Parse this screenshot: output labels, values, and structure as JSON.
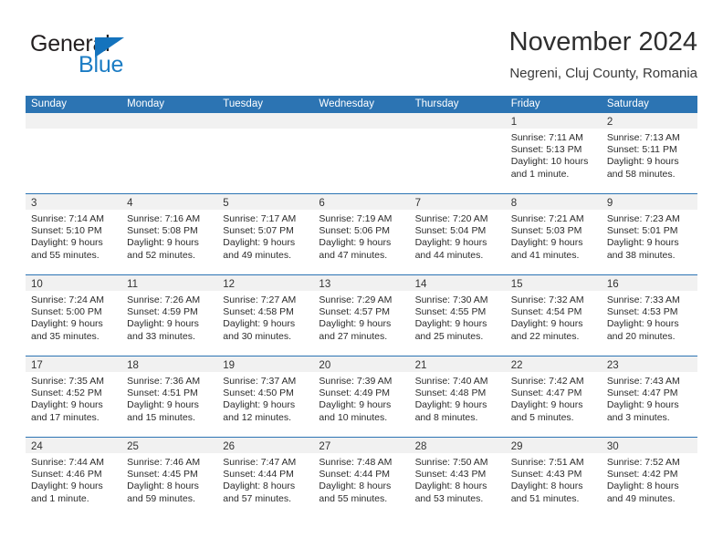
{
  "brand": {
    "name_top": "General",
    "name_bottom": "Blue",
    "triangle_color": "#1473bd",
    "text_color": "#231f20",
    "blue_text_color": "#1b7cc4"
  },
  "header": {
    "title": "November 2024",
    "subtitle": "Negreni, Cluj County, Romania"
  },
  "theme": {
    "header_blue": "#2c74b3",
    "band_gray": "#f1f1f1",
    "text": "#2b2b2b"
  },
  "weekdays": [
    "Sunday",
    "Monday",
    "Tuesday",
    "Wednesday",
    "Thursday",
    "Friday",
    "Saturday"
  ],
  "weeks": [
    [
      {
        "day": ""
      },
      {
        "day": ""
      },
      {
        "day": ""
      },
      {
        "day": ""
      },
      {
        "day": ""
      },
      {
        "day": "1",
        "sunrise": "Sunrise: 7:11 AM",
        "sunset": "Sunset: 5:13 PM",
        "daylight_1": "Daylight: 10 hours",
        "daylight_2": "and 1 minute."
      },
      {
        "day": "2",
        "sunrise": "Sunrise: 7:13 AM",
        "sunset": "Sunset: 5:11 PM",
        "daylight_1": "Daylight: 9 hours",
        "daylight_2": "and 58 minutes."
      }
    ],
    [
      {
        "day": "3",
        "sunrise": "Sunrise: 7:14 AM",
        "sunset": "Sunset: 5:10 PM",
        "daylight_1": "Daylight: 9 hours",
        "daylight_2": "and 55 minutes."
      },
      {
        "day": "4",
        "sunrise": "Sunrise: 7:16 AM",
        "sunset": "Sunset: 5:08 PM",
        "daylight_1": "Daylight: 9 hours",
        "daylight_2": "and 52 minutes."
      },
      {
        "day": "5",
        "sunrise": "Sunrise: 7:17 AM",
        "sunset": "Sunset: 5:07 PM",
        "daylight_1": "Daylight: 9 hours",
        "daylight_2": "and 49 minutes."
      },
      {
        "day": "6",
        "sunrise": "Sunrise: 7:19 AM",
        "sunset": "Sunset: 5:06 PM",
        "daylight_1": "Daylight: 9 hours",
        "daylight_2": "and 47 minutes."
      },
      {
        "day": "7",
        "sunrise": "Sunrise: 7:20 AM",
        "sunset": "Sunset: 5:04 PM",
        "daylight_1": "Daylight: 9 hours",
        "daylight_2": "and 44 minutes."
      },
      {
        "day": "8",
        "sunrise": "Sunrise: 7:21 AM",
        "sunset": "Sunset: 5:03 PM",
        "daylight_1": "Daylight: 9 hours",
        "daylight_2": "and 41 minutes."
      },
      {
        "day": "9",
        "sunrise": "Sunrise: 7:23 AM",
        "sunset": "Sunset: 5:01 PM",
        "daylight_1": "Daylight: 9 hours",
        "daylight_2": "and 38 minutes."
      }
    ],
    [
      {
        "day": "10",
        "sunrise": "Sunrise: 7:24 AM",
        "sunset": "Sunset: 5:00 PM",
        "daylight_1": "Daylight: 9 hours",
        "daylight_2": "and 35 minutes."
      },
      {
        "day": "11",
        "sunrise": "Sunrise: 7:26 AM",
        "sunset": "Sunset: 4:59 PM",
        "daylight_1": "Daylight: 9 hours",
        "daylight_2": "and 33 minutes."
      },
      {
        "day": "12",
        "sunrise": "Sunrise: 7:27 AM",
        "sunset": "Sunset: 4:58 PM",
        "daylight_1": "Daylight: 9 hours",
        "daylight_2": "and 30 minutes."
      },
      {
        "day": "13",
        "sunrise": "Sunrise: 7:29 AM",
        "sunset": "Sunset: 4:57 PM",
        "daylight_1": "Daylight: 9 hours",
        "daylight_2": "and 27 minutes."
      },
      {
        "day": "14",
        "sunrise": "Sunrise: 7:30 AM",
        "sunset": "Sunset: 4:55 PM",
        "daylight_1": "Daylight: 9 hours",
        "daylight_2": "and 25 minutes."
      },
      {
        "day": "15",
        "sunrise": "Sunrise: 7:32 AM",
        "sunset": "Sunset: 4:54 PM",
        "daylight_1": "Daylight: 9 hours",
        "daylight_2": "and 22 minutes."
      },
      {
        "day": "16",
        "sunrise": "Sunrise: 7:33 AM",
        "sunset": "Sunset: 4:53 PM",
        "daylight_1": "Daylight: 9 hours",
        "daylight_2": "and 20 minutes."
      }
    ],
    [
      {
        "day": "17",
        "sunrise": "Sunrise: 7:35 AM",
        "sunset": "Sunset: 4:52 PM",
        "daylight_1": "Daylight: 9 hours",
        "daylight_2": "and 17 minutes."
      },
      {
        "day": "18",
        "sunrise": "Sunrise: 7:36 AM",
        "sunset": "Sunset: 4:51 PM",
        "daylight_1": "Daylight: 9 hours",
        "daylight_2": "and 15 minutes."
      },
      {
        "day": "19",
        "sunrise": "Sunrise: 7:37 AM",
        "sunset": "Sunset: 4:50 PM",
        "daylight_1": "Daylight: 9 hours",
        "daylight_2": "and 12 minutes."
      },
      {
        "day": "20",
        "sunrise": "Sunrise: 7:39 AM",
        "sunset": "Sunset: 4:49 PM",
        "daylight_1": "Daylight: 9 hours",
        "daylight_2": "and 10 minutes."
      },
      {
        "day": "21",
        "sunrise": "Sunrise: 7:40 AM",
        "sunset": "Sunset: 4:48 PM",
        "daylight_1": "Daylight: 9 hours",
        "daylight_2": "and 8 minutes."
      },
      {
        "day": "22",
        "sunrise": "Sunrise: 7:42 AM",
        "sunset": "Sunset: 4:47 PM",
        "daylight_1": "Daylight: 9 hours",
        "daylight_2": "and 5 minutes."
      },
      {
        "day": "23",
        "sunrise": "Sunrise: 7:43 AM",
        "sunset": "Sunset: 4:47 PM",
        "daylight_1": "Daylight: 9 hours",
        "daylight_2": "and 3 minutes."
      }
    ],
    [
      {
        "day": "24",
        "sunrise": "Sunrise: 7:44 AM",
        "sunset": "Sunset: 4:46 PM",
        "daylight_1": "Daylight: 9 hours",
        "daylight_2": "and 1 minute."
      },
      {
        "day": "25",
        "sunrise": "Sunrise: 7:46 AM",
        "sunset": "Sunset: 4:45 PM",
        "daylight_1": "Daylight: 8 hours",
        "daylight_2": "and 59 minutes."
      },
      {
        "day": "26",
        "sunrise": "Sunrise: 7:47 AM",
        "sunset": "Sunset: 4:44 PM",
        "daylight_1": "Daylight: 8 hours",
        "daylight_2": "and 57 minutes."
      },
      {
        "day": "27",
        "sunrise": "Sunrise: 7:48 AM",
        "sunset": "Sunset: 4:44 PM",
        "daylight_1": "Daylight: 8 hours",
        "daylight_2": "and 55 minutes."
      },
      {
        "day": "28",
        "sunrise": "Sunrise: 7:50 AM",
        "sunset": "Sunset: 4:43 PM",
        "daylight_1": "Daylight: 8 hours",
        "daylight_2": "and 53 minutes."
      },
      {
        "day": "29",
        "sunrise": "Sunrise: 7:51 AM",
        "sunset": "Sunset: 4:43 PM",
        "daylight_1": "Daylight: 8 hours",
        "daylight_2": "and 51 minutes."
      },
      {
        "day": "30",
        "sunrise": "Sunrise: 7:52 AM",
        "sunset": "Sunset: 4:42 PM",
        "daylight_1": "Daylight: 8 hours",
        "daylight_2": "and 49 minutes."
      }
    ]
  ]
}
